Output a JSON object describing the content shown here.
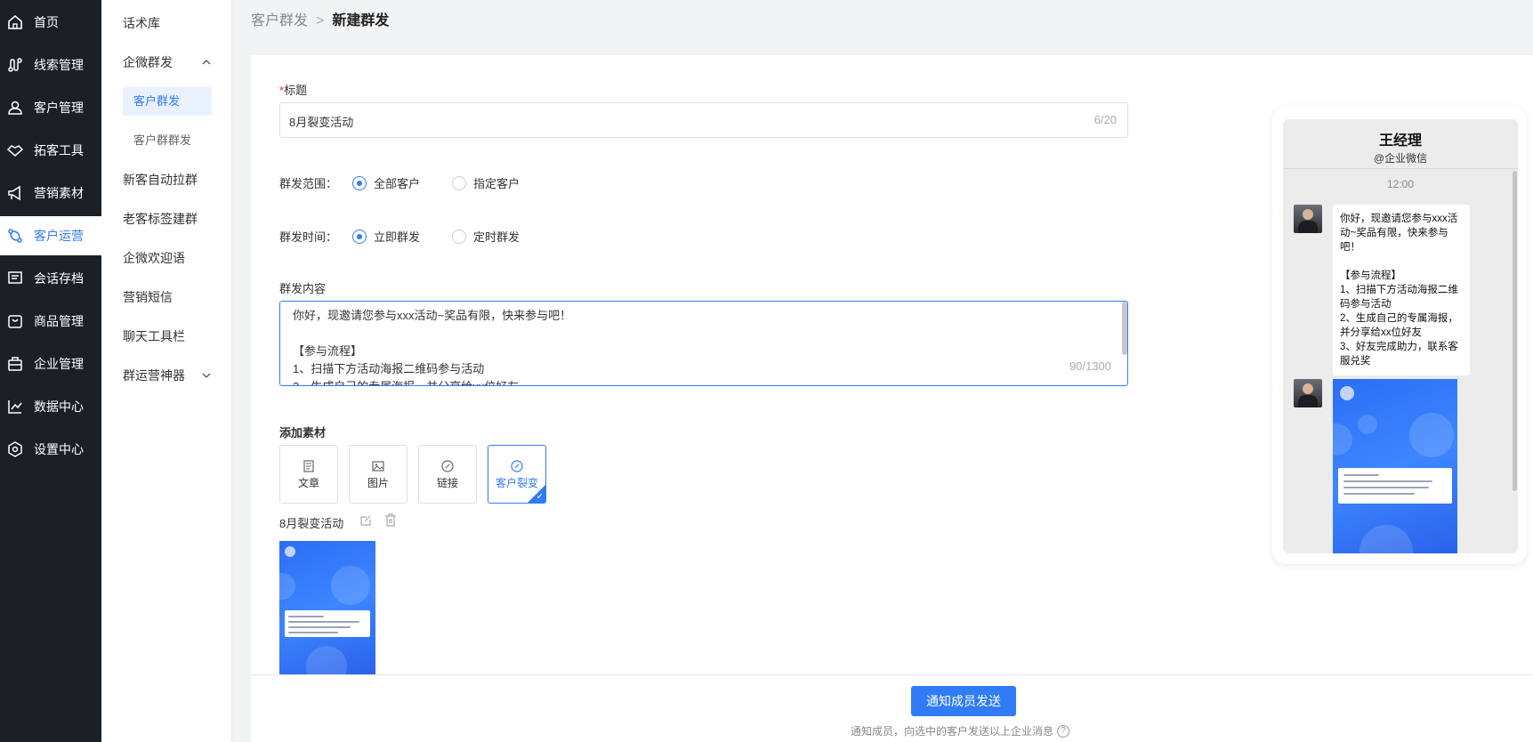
{
  "nav": {
    "items": [
      {
        "label": "首页",
        "icon": "home-icon"
      },
      {
        "label": "线索管理",
        "icon": "route-icon"
      },
      {
        "label": "客户管理",
        "icon": "users-icon"
      },
      {
        "label": "拓客工具",
        "icon": "handshake-icon"
      },
      {
        "label": "营销素材",
        "icon": "megaphone-icon"
      },
      {
        "label": "客户运营",
        "icon": "share-icon",
        "active": true
      },
      {
        "label": "会话存档",
        "icon": "message-icon"
      },
      {
        "label": "商品管理",
        "icon": "bag-icon"
      },
      {
        "label": "企业管理",
        "icon": "briefcase-icon"
      },
      {
        "label": "数据中心",
        "icon": "chart-icon"
      },
      {
        "label": "设置中心",
        "icon": "settings-icon"
      }
    ]
  },
  "submenu": {
    "items": [
      {
        "label": "话术库"
      },
      {
        "label": "企微群发",
        "expanded": true
      },
      {
        "label": "客户群发",
        "child": true,
        "active": true
      },
      {
        "label": "客户群群发",
        "child": true
      },
      {
        "label": "新客自动拉群"
      },
      {
        "label": "老客标签建群"
      },
      {
        "label": "企微欢迎语"
      },
      {
        "label": "营销短信"
      },
      {
        "label": "聊天工具栏"
      },
      {
        "label": "群运营神器",
        "collapsed": true
      }
    ]
  },
  "breadcrumb": {
    "parent": "客户群发",
    "separator": ">",
    "current": "新建群发"
  },
  "form": {
    "title_label_required": "*",
    "title_label": "标题",
    "title_value": "8月裂变活动",
    "title_counter": "6/20",
    "scope_label": "群发范围：",
    "scope_options": [
      {
        "label": "全部客户",
        "selected": true
      },
      {
        "label": "指定客户",
        "selected": false
      }
    ],
    "time_label": "群发时间：",
    "time_options": [
      {
        "label": "立即群发",
        "selected": true
      },
      {
        "label": "定时群发",
        "selected": false
      }
    ],
    "content_label": "群发内容",
    "content_value": "你好，现邀请您参与xxx活动~奖品有限，快来参与吧！\n\n【参与流程】\n1、扫描下方活动海报二维码参与活动\n2、生成自己的专属海报，并分享给xx位好友",
    "content_counter": "90/1300",
    "material_label": "添加素材",
    "materials": [
      {
        "label": "文章",
        "icon": "article-icon",
        "selected": false
      },
      {
        "label": "图片",
        "icon": "image-icon",
        "selected": false
      },
      {
        "label": "链接",
        "icon": "link-icon",
        "selected": false
      },
      {
        "label": "客户裂变",
        "icon": "link-icon",
        "selected": true
      }
    ],
    "attached_title": "8月裂变活动"
  },
  "footer": {
    "send_label": "通知成员发送",
    "hint": "通知成员，向选中的客户发送以上企业消息",
    "help": "?"
  },
  "preview": {
    "name": "王经理",
    "source": "@企业微信",
    "time": "12:00",
    "message": "你好，现邀请您参与xxx活动~奖品有限，快来参与吧！\n\n【参与流程】\n1、扫描下方活动海报二维码参与活动\n2、生成自己的专属海报，并分享给xx位好友\n3、好友完成助力，联系客服兑奖"
  },
  "colors": {
    "accent": "#2f7cf6",
    "nav_bg": "#1c1f26",
    "required": "#f5222d"
  }
}
